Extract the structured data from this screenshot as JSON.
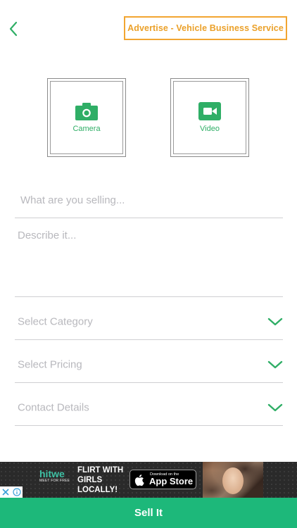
{
  "header": {
    "back_icon": "chevron-left-icon",
    "advertise_label": "Advertise - Vehicle Business Service"
  },
  "media": {
    "camera": {
      "label": "Camera",
      "icon": "camera-icon"
    },
    "video": {
      "label": "Video",
      "icon": "video-camera-icon"
    }
  },
  "form": {
    "title_placeholder": "What are you selling...",
    "title_value": "",
    "description_placeholder": "Describe it...",
    "description_value": "",
    "selects": [
      {
        "label": "Select Category",
        "icon": "chevron-down-icon"
      },
      {
        "label": "Select Pricing",
        "icon": "chevron-down-icon"
      },
      {
        "label": "Contact Details",
        "icon": "chevron-down-icon"
      }
    ]
  },
  "ad": {
    "brand": "hitwe",
    "brand_tagline": "MEET FOR FREE",
    "headline_lines": [
      "FLIRT WITH",
      "GIRLS",
      "LOCALLY!"
    ],
    "store_small": "Download on the",
    "store_big": "App Store",
    "close_icon": "close-icon",
    "info_icon": "info-icon"
  },
  "footer": {
    "sell_label": "Sell It"
  },
  "colors": {
    "accent_green": "#1db87a",
    "icon_green": "#2fae66",
    "advertise_orange": "#eba12a",
    "placeholder_gray": "#b8b8bd"
  }
}
